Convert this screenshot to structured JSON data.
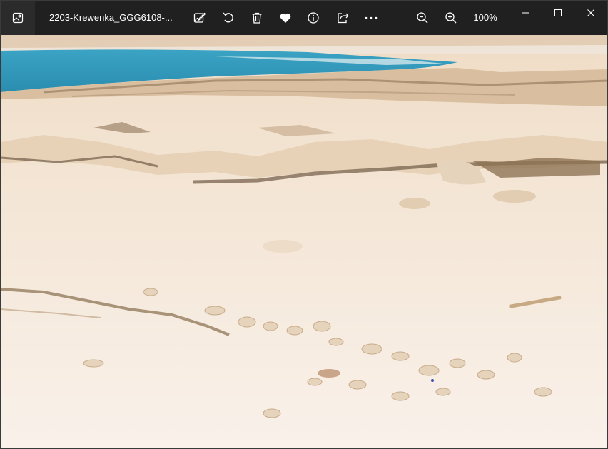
{
  "window": {
    "file_title": "2203-Krewenka_GGG6108-...",
    "zoom_level": "100%"
  },
  "toolbar": {
    "icons": [
      "edit-image-icon",
      "rotate-icon",
      "delete-icon",
      "favorite-heart-icon",
      "info-icon",
      "share-icon",
      "more-icon",
      "zoom-out-icon",
      "zoom-in-icon"
    ]
  },
  "window_controls": [
    "minimize-icon",
    "maximize-icon",
    "close-icon"
  ],
  "photo": {
    "subject": "salt flat shoreline with blue water",
    "colors": {
      "water": "#2f95b8",
      "salt": "#f4e6d6",
      "rock": "#b89a78",
      "shadow": "#6f5a44"
    }
  }
}
